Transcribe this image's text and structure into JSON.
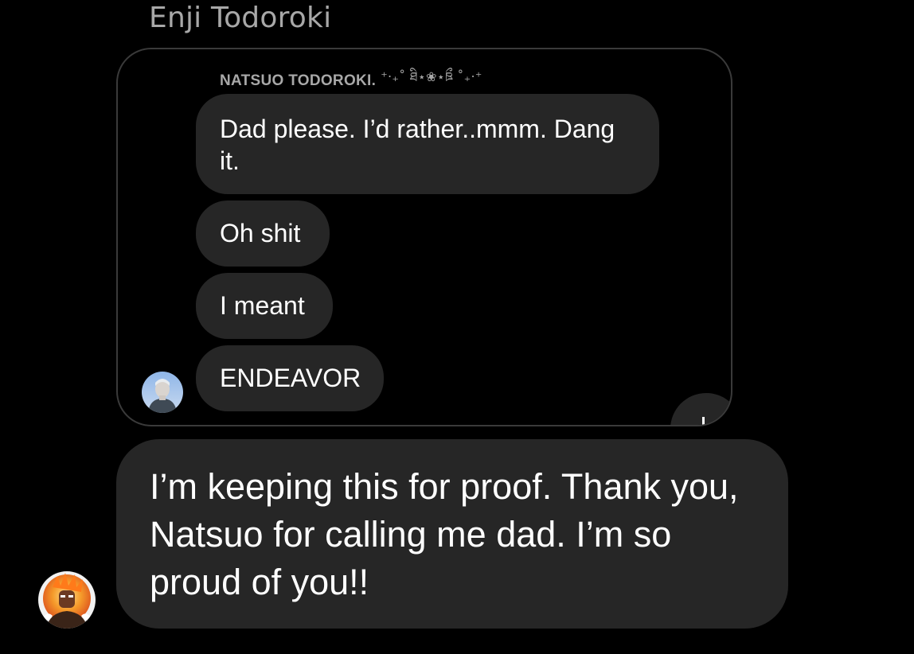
{
  "conversation": {
    "sender_name": "Enji Todoroki"
  },
  "shared_post": {
    "author": "NATSUO TODOROKI.",
    "author_decoration": "⁺‧₊˚ ཐི⋆❀⋆ཋྀ ˚₊‧⁺",
    "messages": [
      "Dad please. I’d rather..mmm. Dang it.",
      "Oh shit",
      "I meant",
      "ENDEAVOR"
    ]
  },
  "reply_message": {
    "text": "I’m keeping this for proof. Thank you, Natsuo for calling me dad. I’m so proud of you!!"
  },
  "icons": {
    "shared_author_avatar": "avatar-natsuo",
    "sender_avatar": "avatar-enji",
    "corner_reaction": "reaction-badge"
  },
  "colors": {
    "background": "#000000",
    "bubble": "#262626",
    "muted_text": "#a8a8a8",
    "card_border": "#3a3a3a"
  }
}
